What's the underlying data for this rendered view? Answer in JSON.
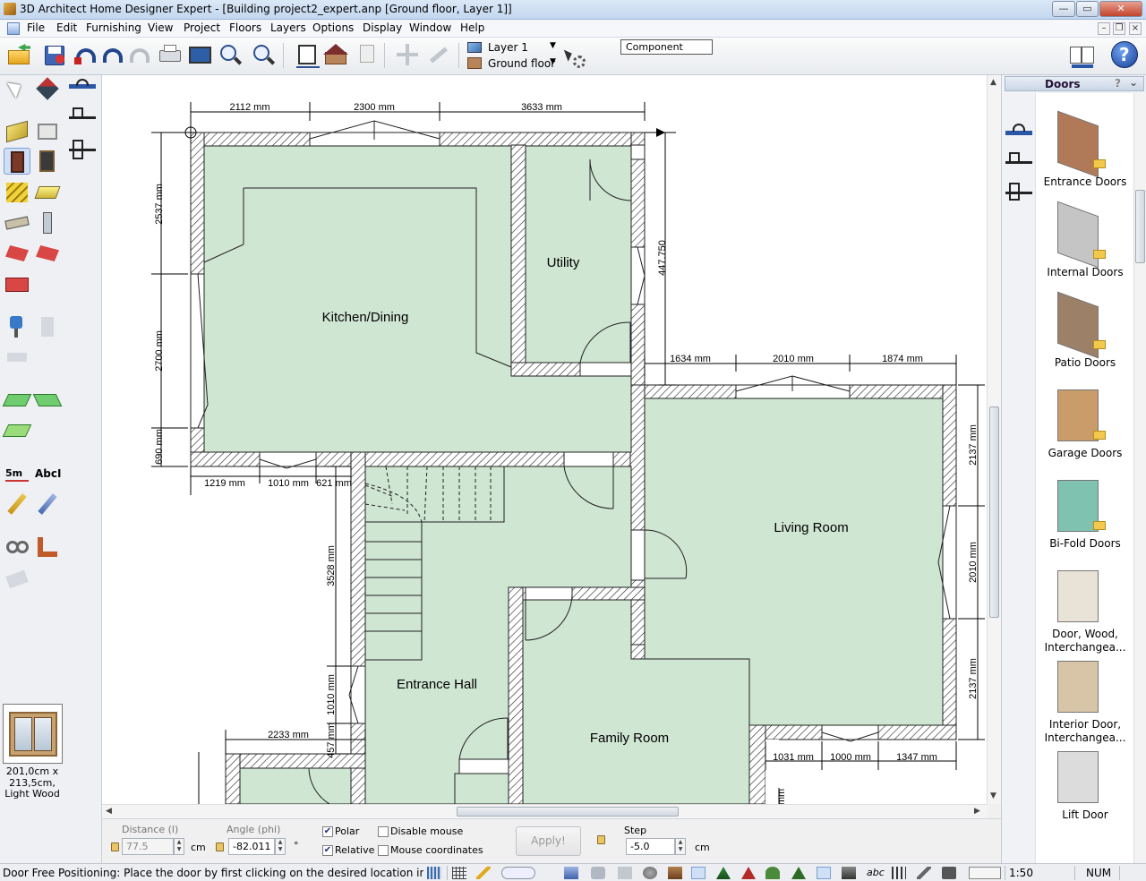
{
  "window": {
    "title": "3D Architect Home Designer Expert - [Building project2_expert.anp [Ground floor, Layer 1]]",
    "controls": {
      "minimize": "—",
      "maximize": "▭",
      "close": "✕"
    },
    "mdi_controls": {
      "minimize": "–",
      "restore": "❐",
      "close": "×"
    }
  },
  "menu": {
    "items": [
      "File",
      "Edit",
      "Furnishing",
      "View",
      "Project",
      "Floors",
      "Layers",
      "Options",
      "Display",
      "Window",
      "Help"
    ]
  },
  "toolbar": {
    "layer": "Layer 1",
    "floor": "Ground floor",
    "component": "Component"
  },
  "left_panel": {
    "preview_label": "201,0cm x 213,5cm, Light Wood"
  },
  "plan": {
    "rooms": [
      {
        "id": "kitchen",
        "label": "Kitchen/Dining"
      },
      {
        "id": "utility",
        "label": "Utility"
      },
      {
        "id": "living",
        "label": "Living Room"
      },
      {
        "id": "hall",
        "label": "Entrance Hall"
      },
      {
        "id": "family",
        "label": "Family Room"
      }
    ],
    "dims": {
      "top1": "2112 mm",
      "top2": "2300 mm",
      "top3": "3633 mm",
      "left1": "2537 mm",
      "left2": "2700 mm",
      "left3": "690 mm",
      "right_vert": "447.750",
      "bot1": "1219 mm",
      "bot2": "1010 mm",
      "bot3": "621 mm",
      "mid1": "1634 mm",
      "mid2": "2010 mm",
      "mid3": "1874 mm",
      "lr1": "2137 mm",
      "lr2": "2010 mm",
      "lr3": "2137 mm",
      "hall1": "3528 mm",
      "hall2": "1010 mm",
      "hall3": "457 mm",
      "lower_left": "2233 mm",
      "lowr1": "1031 mm",
      "lowr2": "1000 mm",
      "lowr3": "1347 mm",
      "cut": "mm"
    }
  },
  "catalog": {
    "title": "Doors",
    "help": "?",
    "items": [
      {
        "label": "Entrance Doors",
        "color": "#b07a58"
      },
      {
        "label": "Internal Doors",
        "color": "#c5c5c5"
      },
      {
        "label": "Patio Doors",
        "color": "#9c8068"
      },
      {
        "label": "Garage Doors",
        "color": "#c99c6a"
      },
      {
        "label": "Bi-Fold Doors",
        "color": "#7fc2b0"
      },
      {
        "label": "Door, Wood, Interchangea...",
        "color": "#e9e2d6"
      },
      {
        "label": "Interior Door, Interchangea...",
        "color": "#d8c4a6"
      },
      {
        "label": "Lift Door",
        "color": "#dcdcdc"
      }
    ]
  },
  "input_panel": {
    "distance_label": "Distance (l)",
    "distance_value": "77.5",
    "distance_unit": "cm",
    "angle_label": "Angle (phi)",
    "angle_value": "-82.011",
    "angle_unit": "°",
    "polar_label": "Polar",
    "polar_checked": "✔",
    "relative_label": "Relative",
    "relative_checked": "✔",
    "disable_mouse_label": "Disable mouse",
    "mouse_coords_label": "Mouse coordinates",
    "apply_label": "Apply!",
    "step_label": "Step",
    "step_value": "-5.0",
    "step_unit": "cm"
  },
  "status": {
    "message": "Door Free Positioning: Place the door by first clicking on the desired location in an existing wall.",
    "scale": "1:50",
    "num": "NUM"
  }
}
